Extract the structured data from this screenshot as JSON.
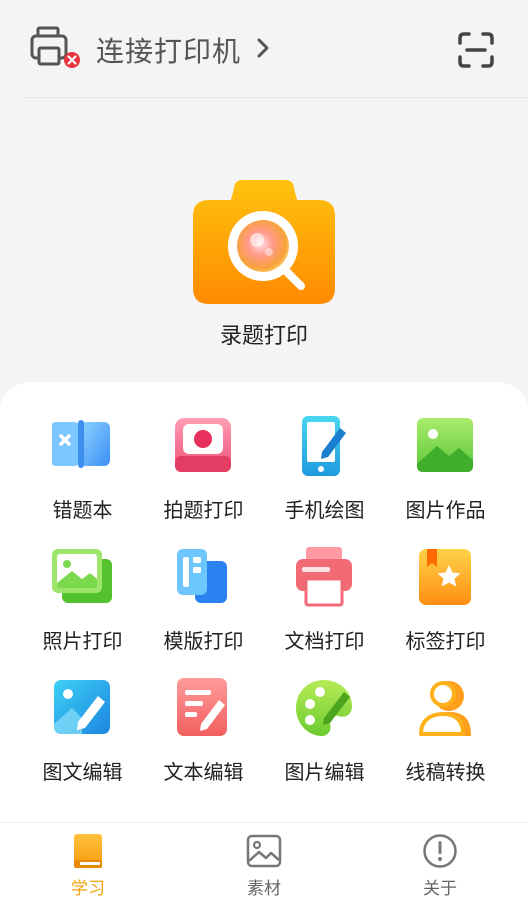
{
  "header": {
    "connect_label": "连接打印机",
    "chevron_icon": "chevron-right-icon",
    "printer_icon": "printer-disconnected-icon",
    "scan_icon": "scan-icon"
  },
  "hero": {
    "label": "录题打印",
    "icon": "camera-search-icon"
  },
  "features": [
    {
      "label": "错题本",
      "icon": "book-x-icon"
    },
    {
      "label": "拍题打印",
      "icon": "camera-print-icon"
    },
    {
      "label": "手机绘图",
      "icon": "phone-draw-icon"
    },
    {
      "label": "图片作品",
      "icon": "image-icon"
    },
    {
      "label": "照片打印",
      "icon": "photo-stack-icon"
    },
    {
      "label": "模版打印",
      "icon": "template-icon"
    },
    {
      "label": "文档打印",
      "icon": "document-print-icon"
    },
    {
      "label": "标签打印",
      "icon": "label-star-icon"
    },
    {
      "label": "图文编辑",
      "icon": "image-text-edit-icon"
    },
    {
      "label": "文本编辑",
      "icon": "text-edit-icon"
    },
    {
      "label": "图片编辑",
      "icon": "palette-icon"
    },
    {
      "label": "线稿转换",
      "icon": "person-outline-icon"
    }
  ],
  "tabs": [
    {
      "label": "学习",
      "icon": "book-icon",
      "active": true
    },
    {
      "label": "素材",
      "icon": "picture-icon",
      "active": false
    },
    {
      "label": "关于",
      "icon": "info-icon",
      "active": false
    }
  ],
  "colors": {
    "accent": "#f5a20b",
    "background": "#f4f4f4",
    "panel": "#ffffff",
    "text": "#222222"
  }
}
